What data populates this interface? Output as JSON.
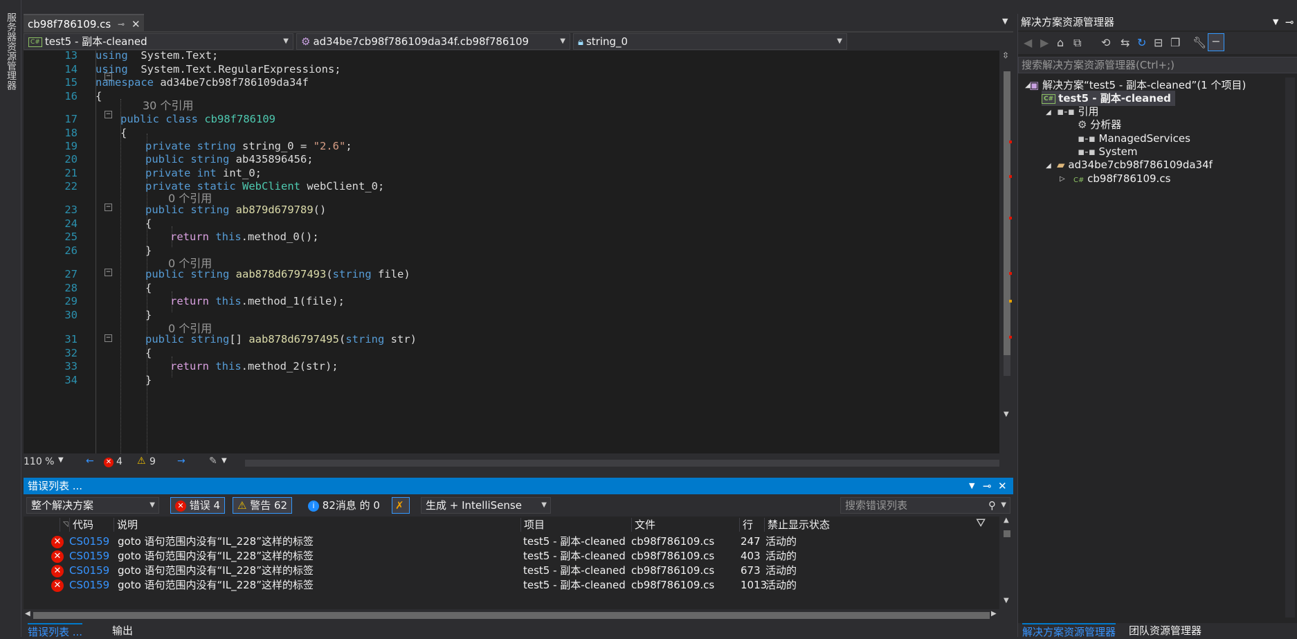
{
  "left_strip": {
    "label": "服务器资源管理器"
  },
  "doc_tab": {
    "title": "cb98f786109.cs"
  },
  "navbar": {
    "project": "test5 - 副本-cleaned",
    "type": "ad34be7cb98f786109da34f.cb98f786109",
    "member": "string_0"
  },
  "editor": {
    "lines": [
      {
        "n": "13",
        "t": [
          [
            "kw",
            "using"
          ],
          [
            "",
            "  System.Text;"
          ]
        ]
      },
      {
        "n": "14",
        "t": [
          [
            "kw",
            "using"
          ],
          [
            "",
            "  System.Text.RegularExpressions;"
          ]
        ]
      },
      {
        "n": "15",
        "t": [
          [
            "kw",
            "namespace"
          ],
          [
            "",
            " ad34be7cb98f786109da34f"
          ]
        ]
      },
      {
        "n": "16",
        "t": [
          [
            "",
            "{"
          ]
        ]
      },
      {
        "n": "17",
        "t": [
          [
            "kw",
            "public class"
          ],
          [
            "",
            " "
          ],
          [
            "ty",
            "cb98f786109"
          ]
        ]
      },
      {
        "n": "18",
        "t": [
          [
            "",
            "{"
          ]
        ]
      },
      {
        "n": "19",
        "t": [
          [
            "kw",
            "private string"
          ],
          [
            "",
            " string_0 = "
          ],
          [
            "str",
            "\"2.6\""
          ],
          [
            "",
            ";"
          ]
        ]
      },
      {
        "n": "20",
        "t": [
          [
            "kw",
            "public string"
          ],
          [
            "",
            " ab435896456;"
          ]
        ]
      },
      {
        "n": "21",
        "t": [
          [
            "kw",
            "private int"
          ],
          [
            "",
            " int_0;"
          ]
        ]
      },
      {
        "n": "22",
        "t": [
          [
            "kw",
            "private static"
          ],
          [
            "",
            " "
          ],
          [
            "ty",
            "WebClient"
          ],
          [
            "",
            " webClient_0;"
          ]
        ]
      },
      {
        "n": "23",
        "t": [
          [
            "kw",
            "public string"
          ],
          [
            "",
            " "
          ],
          [
            "mth",
            "ab879d679789"
          ],
          [
            "",
            "()"
          ]
        ]
      },
      {
        "n": "24",
        "t": [
          [
            "",
            "{"
          ]
        ]
      },
      {
        "n": "25",
        "t": [
          [
            "ctl",
            "return"
          ],
          [
            "",
            " "
          ],
          [
            "kw",
            "this"
          ],
          [
            "",
            ".method_0();"
          ]
        ]
      },
      {
        "n": "26",
        "t": [
          [
            "",
            "}"
          ]
        ]
      },
      {
        "n": "27",
        "t": [
          [
            "kw",
            "public string"
          ],
          [
            "",
            " "
          ],
          [
            "mth",
            "aab878d6797493"
          ],
          [
            "",
            "("
          ],
          [
            "kw",
            "string"
          ],
          [
            "",
            " file)"
          ]
        ]
      },
      {
        "n": "28",
        "t": [
          [
            "",
            "{"
          ]
        ]
      },
      {
        "n": "29",
        "t": [
          [
            "ctl",
            "return"
          ],
          [
            "",
            " "
          ],
          [
            "kw",
            "this"
          ],
          [
            "",
            ".method_1(file);"
          ]
        ]
      },
      {
        "n": "30",
        "t": [
          [
            "",
            "}"
          ]
        ]
      },
      {
        "n": "31",
        "t": [
          [
            "kw",
            "public string"
          ],
          [
            "",
            "[] "
          ],
          [
            "mth",
            "aab878d6797495"
          ],
          [
            "",
            "("
          ],
          [
            "kw",
            "string"
          ],
          [
            "",
            " str)"
          ]
        ]
      },
      {
        "n": "32",
        "t": [
          [
            "",
            "{"
          ]
        ]
      },
      {
        "n": "33",
        "t": [
          [
            "ctl",
            "return"
          ],
          [
            "",
            " "
          ],
          [
            "kw",
            "this"
          ],
          [
            "",
            ".method_2(str);"
          ]
        ]
      },
      {
        "n": "34",
        "t": [
          [
            "",
            "}"
          ]
        ]
      }
    ],
    "lens_30": "30 个引用",
    "lens_0": "0 个引用"
  },
  "editor_status": {
    "zoom": "110 %",
    "errors": "4",
    "warnings": "9"
  },
  "error_list": {
    "title": "错误列表 ...",
    "scope": "整个解决方案",
    "errors_btn": "错误 4",
    "warnings_btn": "警告 62",
    "messages_btn": "82消息 的 0",
    "build_filter": "生成 + IntelliSense",
    "search_placeholder": "搜索错误列表",
    "columns": {
      "code": "代码",
      "desc": "说明",
      "project": "项目",
      "file": "文件",
      "line": "行",
      "suppress": "禁止显示状态"
    },
    "rows": [
      {
        "code": "CS0159",
        "desc": "goto 语句范围内没有“IL_228”这样的标签",
        "project": "test5 - 副本-cleaned",
        "file": "cb98f786109.cs",
        "line": "247",
        "state": "活动的"
      },
      {
        "code": "CS0159",
        "desc": "goto 语句范围内没有“IL_228”这样的标签",
        "project": "test5 - 副本-cleaned",
        "file": "cb98f786109.cs",
        "line": "403",
        "state": "活动的"
      },
      {
        "code": "CS0159",
        "desc": "goto 语句范围内没有“IL_228”这样的标签",
        "project": "test5 - 副本-cleaned",
        "file": "cb98f786109.cs",
        "line": "673",
        "state": "活动的"
      },
      {
        "code": "CS0159",
        "desc": "goto 语句范围内没有“IL_228”这样的标签",
        "project": "test5 - 副本-cleaned",
        "file": "cb98f786109.cs",
        "line": "1013",
        "state": "活动的"
      }
    ]
  },
  "bottom_tabs": {
    "errors": "错误列表 ...",
    "output": "输出"
  },
  "solution_explorer": {
    "title": "解决方案资源管理器",
    "search_placeholder": "搜索解决方案资源管理器(Ctrl+;)",
    "solution": "解决方案“test5 - 副本-cleaned”(1 个项目)",
    "project": "test5 - 副本-cleaned",
    "references": "引用",
    "ref_items": [
      "分析器",
      "ManagedServices",
      "System"
    ],
    "namespace_folder": "ad34be7cb98f786109da34f",
    "file": "cb98f786109.cs",
    "tab_se": "解决方案资源管理器",
    "tab_team": "团队资源管理器"
  },
  "colors": {
    "accent": "#007acc",
    "keyword": "#569cd6",
    "type": "#4ec9b0",
    "string": "#d69d85",
    "error": "#e51400"
  }
}
